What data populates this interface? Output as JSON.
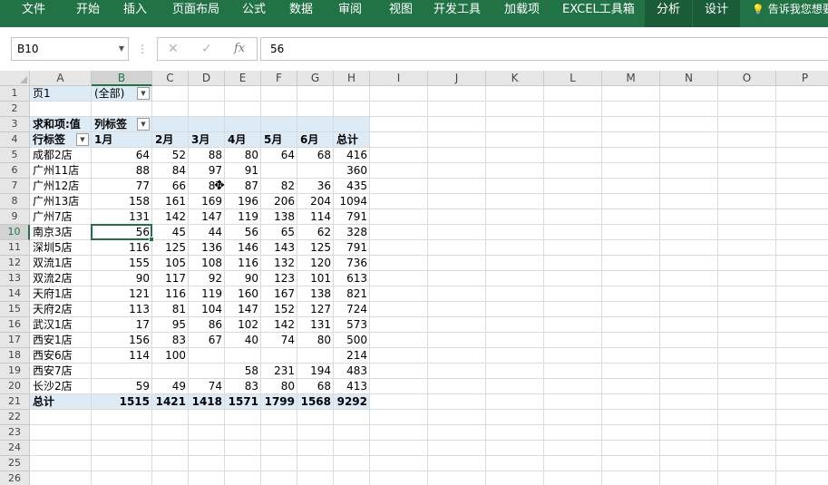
{
  "ribbon": {
    "tabs": [
      "文件",
      "开始",
      "插入",
      "页面布局",
      "公式",
      "数据",
      "审阅",
      "视图",
      "开发工具",
      "加载项",
      "EXCEL工具箱",
      "分析",
      "设计"
    ],
    "highlighted": [
      "分析",
      "设计"
    ],
    "tell_me": "告诉我您想要"
  },
  "formula_bar": {
    "name_box": "B10",
    "cancel_icon": "✕",
    "enter_icon": "✓",
    "fx_label": "fx",
    "content": "56"
  },
  "columns": [
    "A",
    "B",
    "C",
    "D",
    "E",
    "F",
    "G",
    "H",
    "I",
    "J",
    "K",
    "L",
    "M",
    "N",
    "O",
    "P"
  ],
  "rows": [
    "1",
    "2",
    "3",
    "4",
    "5",
    "6",
    "7",
    "8",
    "9",
    "10",
    "11",
    "12",
    "13",
    "14",
    "15",
    "16",
    "17",
    "18",
    "19",
    "20",
    "21",
    "22",
    "23",
    "24",
    "25",
    "26"
  ],
  "selected_cell": {
    "column": "B",
    "row": "10"
  },
  "pivot": {
    "page_field_label": "页1",
    "page_field_value": "(全部)",
    "value_label": "求和项:值",
    "column_labels": "列标签",
    "row_labels": "行标签",
    "months": [
      "1月",
      "2月",
      "3月",
      "4月",
      "5月",
      "6月"
    ],
    "total_label": "总计",
    "stores": [
      {
        "name": "成都2店",
        "values": [
          "64",
          "52",
          "88",
          "80",
          "64",
          "68"
        ],
        "total": "416"
      },
      {
        "name": "广州11店",
        "values": [
          "88",
          "84",
          "97",
          "91",
          "",
          ""
        ],
        "total": "360"
      },
      {
        "name": "广州12店",
        "values": [
          "77",
          "66",
          "87",
          "87",
          "82",
          "36"
        ],
        "total": "435"
      },
      {
        "name": "广州13店",
        "values": [
          "158",
          "161",
          "169",
          "196",
          "206",
          "204"
        ],
        "total": "1094"
      },
      {
        "name": "广州7店",
        "values": [
          "131",
          "142",
          "147",
          "119",
          "138",
          "114"
        ],
        "total": "791"
      },
      {
        "name": "南京3店",
        "values": [
          "56",
          "45",
          "44",
          "56",
          "65",
          "62"
        ],
        "total": "328"
      },
      {
        "name": "深圳5店",
        "values": [
          "116",
          "125",
          "136",
          "146",
          "143",
          "125"
        ],
        "total": "791"
      },
      {
        "name": "双流1店",
        "values": [
          "155",
          "105",
          "108",
          "116",
          "132",
          "120"
        ],
        "total": "736"
      },
      {
        "name": "双流2店",
        "values": [
          "90",
          "117",
          "92",
          "90",
          "123",
          "101"
        ],
        "total": "613"
      },
      {
        "name": "天府1店",
        "values": [
          "121",
          "116",
          "119",
          "160",
          "167",
          "138"
        ],
        "total": "821"
      },
      {
        "name": "天府2店",
        "values": [
          "113",
          "81",
          "104",
          "147",
          "152",
          "127"
        ],
        "total": "724"
      },
      {
        "name": "武汉1店",
        "values": [
          "17",
          "95",
          "86",
          "102",
          "142",
          "131"
        ],
        "total": "573"
      },
      {
        "name": "西安1店",
        "values": [
          "156",
          "83",
          "67",
          "40",
          "74",
          "80"
        ],
        "total": "500"
      },
      {
        "name": "西安6店",
        "values": [
          "114",
          "100",
          "",
          "",
          "",
          ""
        ],
        "total": "214"
      },
      {
        "name": "西安7店",
        "values": [
          "",
          "",
          "",
          "58",
          "231",
          "194"
        ],
        "total": "483"
      },
      {
        "name": "长沙2店",
        "values": [
          "59",
          "49",
          "74",
          "83",
          "80",
          "68"
        ],
        "total": "413"
      }
    ],
    "grand_total": {
      "values": [
        "1515",
        "1421",
        "1418",
        "1571",
        "1799",
        "1568"
      ],
      "total": "9292"
    }
  }
}
